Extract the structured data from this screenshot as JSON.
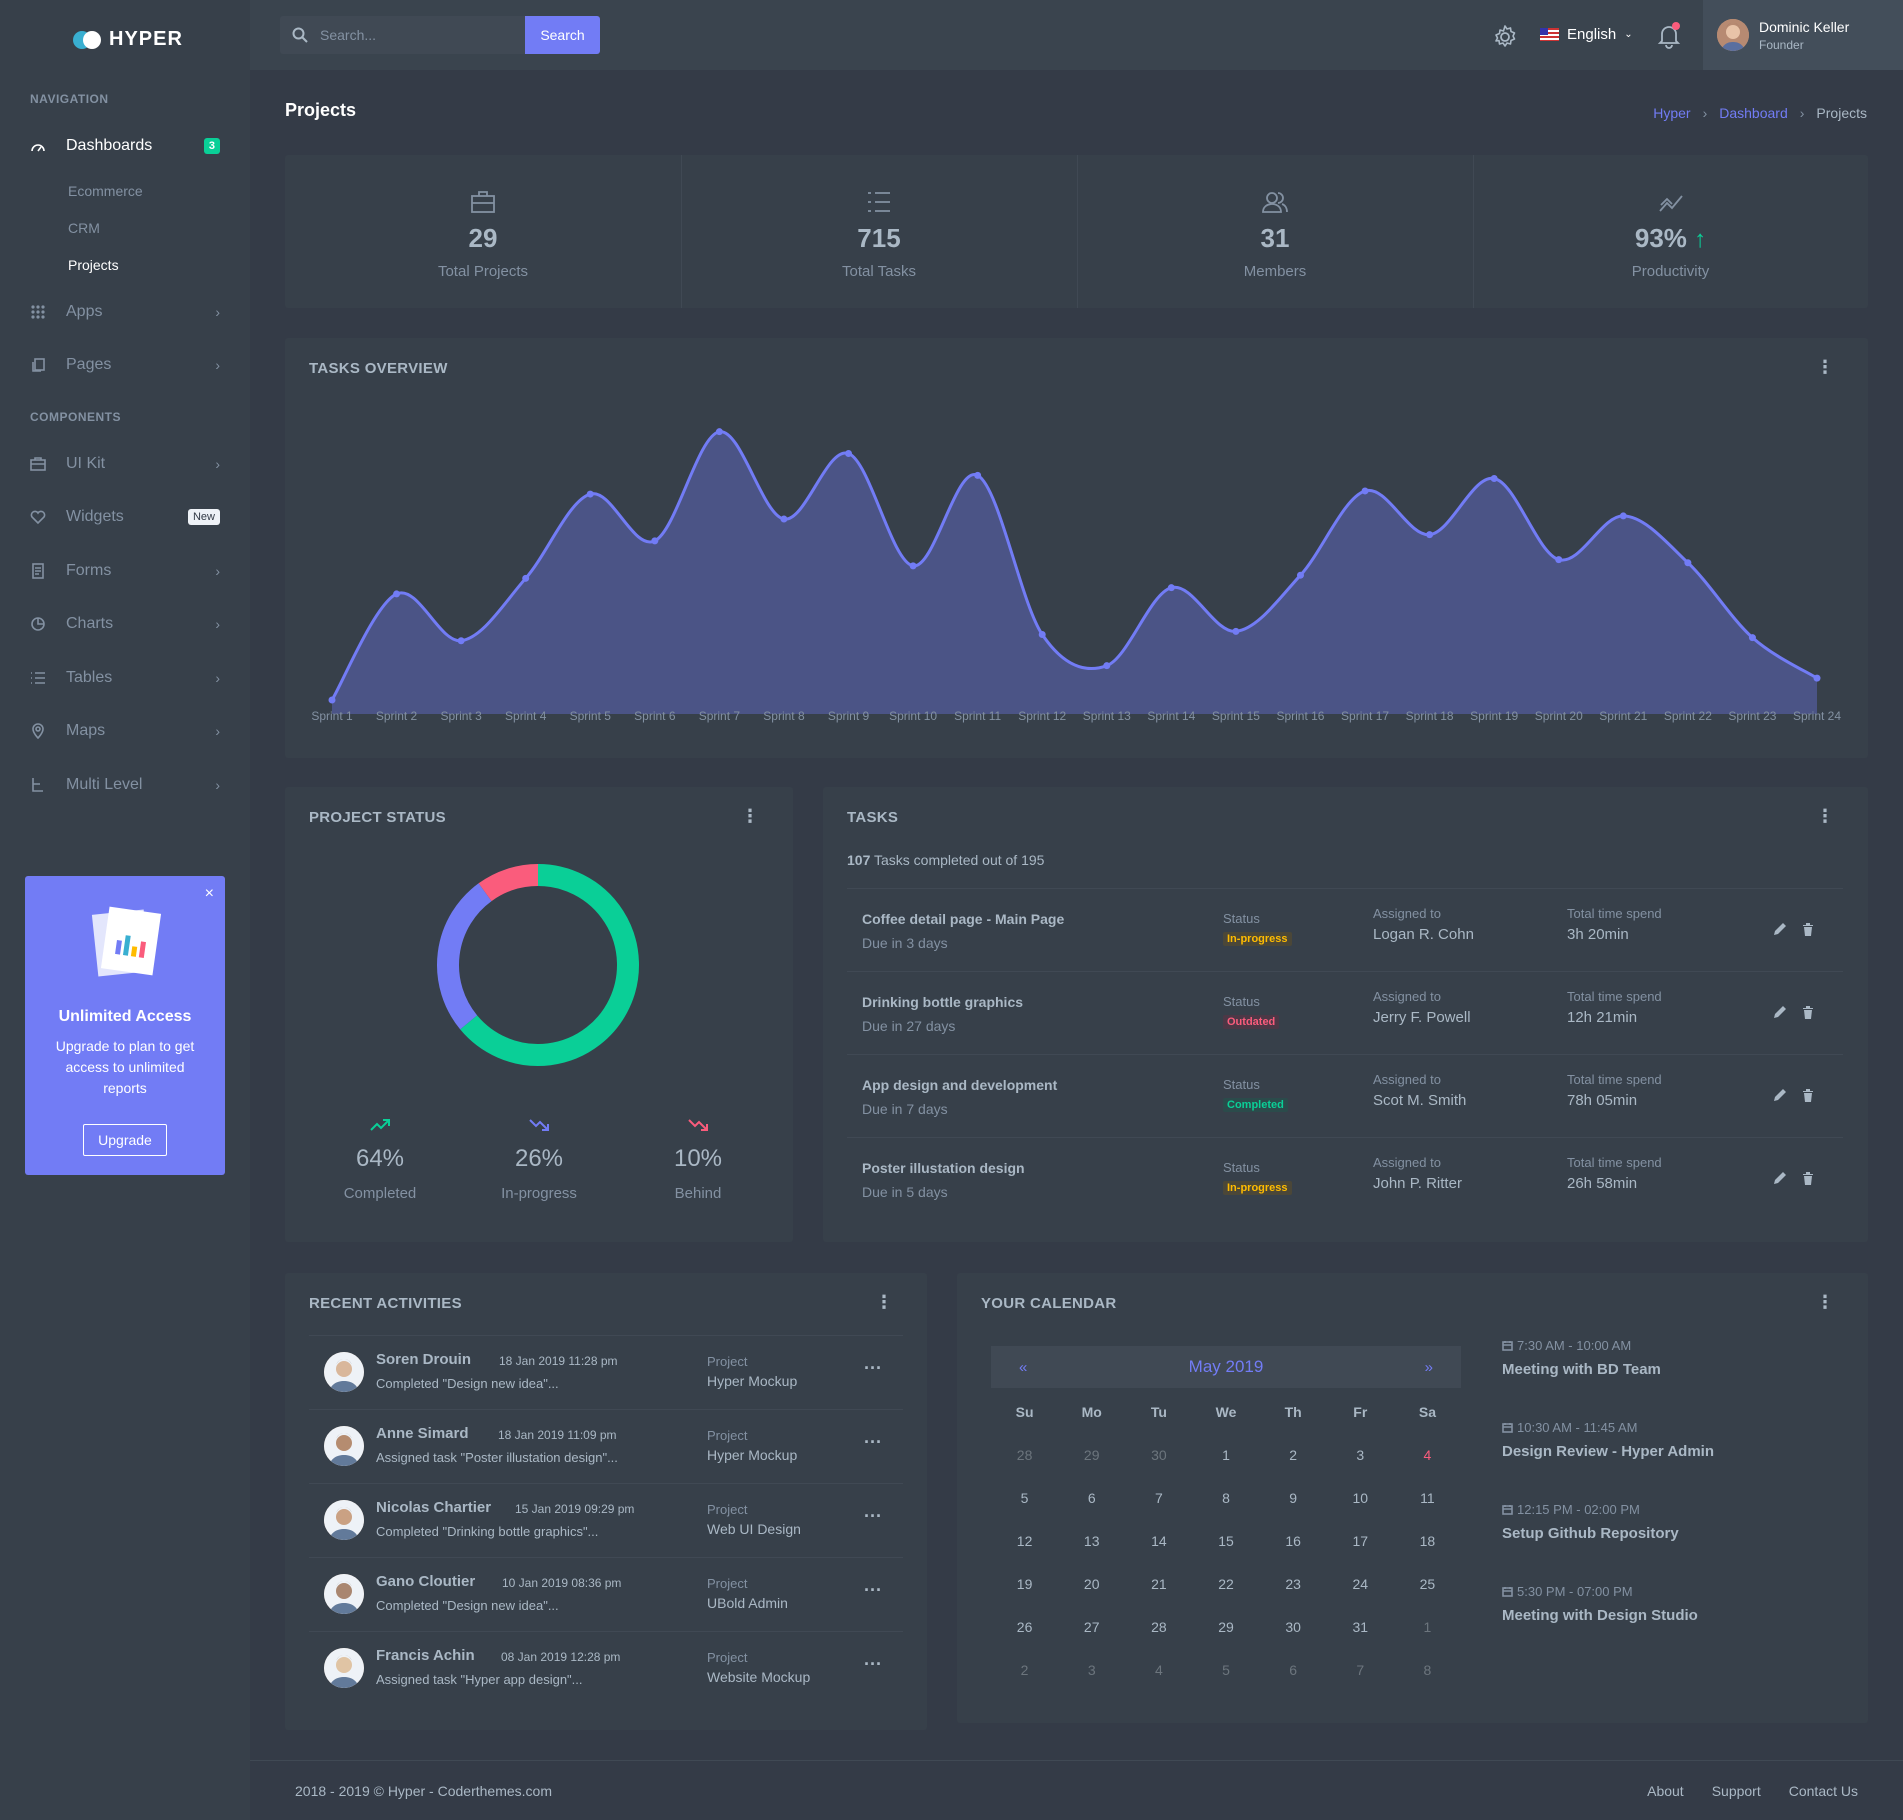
{
  "brand": {
    "name": "HYPER"
  },
  "sidebar": {
    "nav_title": "NAVIGATION",
    "components_title": "COMPONENTS",
    "dashboards": {
      "label": "Dashboards",
      "badge": "3",
      "sub": [
        "Ecommerce",
        "CRM",
        "Projects"
      ]
    },
    "apps": "Apps",
    "pages": "Pages",
    "items": [
      {
        "label": "UI Kit",
        "icon": "briefcase-icon"
      },
      {
        "label": "Widgets",
        "icon": "heart-icon",
        "badge": "New"
      },
      {
        "label": "Forms",
        "icon": "document-icon"
      },
      {
        "label": "Charts",
        "icon": "pie-chart-icon"
      },
      {
        "label": "Tables",
        "icon": "list-icon"
      },
      {
        "label": "Maps",
        "icon": "map-pin-icon"
      },
      {
        "label": "Multi Level",
        "icon": "tree-icon"
      }
    ],
    "promo": {
      "title": "Unlimited Access",
      "text": "Upgrade to plan to get access to unlimited reports",
      "button": "Upgrade"
    }
  },
  "topbar": {
    "search_placeholder": "Search...",
    "search_button": "Search",
    "language": "English",
    "user_name": "Dominic Keller",
    "user_role": "Founder"
  },
  "page": {
    "title": "Projects",
    "breadcrumb": [
      "Hyper",
      "Dashboard",
      "Projects"
    ]
  },
  "stats": [
    {
      "value": "29",
      "label": "Total Projects",
      "icon": "briefcase-icon"
    },
    {
      "value": "715",
      "label": "Total Tasks",
      "icon": "list-icon"
    },
    {
      "value": "31",
      "label": "Members",
      "icon": "users-icon"
    },
    {
      "value": "93%",
      "label": "Productivity",
      "icon": "trend-icon"
    }
  ],
  "tasks_overview": {
    "title": "TASKS OVERVIEW"
  },
  "chart_data": {
    "type": "area",
    "title": "TASKS OVERVIEW",
    "categories": [
      "Sprint 1",
      "Sprint 2",
      "Sprint 3",
      "Sprint 4",
      "Sprint 5",
      "Sprint 6",
      "Sprint 7",
      "Sprint 8",
      "Sprint 9",
      "Sprint 10",
      "Sprint 11",
      "Sprint 12",
      "Sprint 13",
      "Sprint 14",
      "Sprint 15",
      "Sprint 16",
      "Sprint 17",
      "Sprint 18",
      "Sprint 19",
      "Sprint 20",
      "Sprint 21",
      "Sprint 22",
      "Sprint 23",
      "Sprint 24"
    ],
    "values": [
      0,
      34,
      19,
      39,
      66,
      51,
      86,
      58,
      79,
      43,
      72,
      21,
      11,
      36,
      22,
      40,
      67,
      53,
      71,
      45,
      59,
      44,
      20,
      7
    ],
    "ylim": [
      0,
      100
    ],
    "color": "#727cf5",
    "grid": false
  },
  "project_status": {
    "title": "PROJECT STATUS",
    "chart_data": {
      "type": "pie",
      "values": [
        64,
        26,
        10
      ],
      "labels": [
        "Completed",
        "In-progress",
        "Behind"
      ],
      "colors": [
        "#0acf97",
        "#727cf5",
        "#fa5c7c"
      ]
    },
    "legend": [
      {
        "pct": "64%",
        "label": "Completed",
        "color": "#0acf97"
      },
      {
        "pct": "26%",
        "label": "In-progress",
        "color": "#727cf5"
      },
      {
        "pct": "10%",
        "label": "Behind",
        "color": "#fa5c7c"
      }
    ]
  },
  "tasks": {
    "title": "TASKS",
    "summary_count": "107",
    "summary_text": "Tasks completed out of 195",
    "status_label": "Status",
    "assigned_label": "Assigned to",
    "time_label": "Total time spend",
    "rows": [
      {
        "title": "Coffee detail page - Main Page",
        "due": "Due in 3 days",
        "status": "In-progress",
        "assignee": "Logan R. Cohn",
        "time": "3h 20min"
      },
      {
        "title": "Drinking bottle graphics",
        "due": "Due in 27 days",
        "status": "Outdated",
        "assignee": "Jerry F. Powell",
        "time": "12h 21min"
      },
      {
        "title": "App design and development",
        "due": "Due in 7 days",
        "status": "Completed",
        "assignee": "Scot M. Smith",
        "time": "78h 05min"
      },
      {
        "title": "Poster illustation design",
        "due": "Due in 5 days",
        "status": "In-progress",
        "assignee": "John P. Ritter",
        "time": "26h 58min"
      }
    ]
  },
  "activities": {
    "title": "RECENT ACTIVITIES",
    "project_label": "Project",
    "rows": [
      {
        "name": "Soren Drouin",
        "time": "18 Jan 2019 11:28 pm",
        "desc": "Completed \"Design new idea\"...",
        "project": "Hyper Mockup"
      },
      {
        "name": "Anne Simard",
        "time": "18 Jan 2019 11:09 pm",
        "desc": "Assigned task \"Poster illustation design\"...",
        "project": "Hyper Mockup"
      },
      {
        "name": "Nicolas Chartier",
        "time": "15 Jan 2019 09:29 pm",
        "desc": "Completed \"Drinking bottle graphics\"...",
        "project": "Web UI Design"
      },
      {
        "name": "Gano Cloutier",
        "time": "10 Jan 2019 08:36 pm",
        "desc": "Completed \"Design new idea\"...",
        "project": "UBold Admin"
      },
      {
        "name": "Francis Achin",
        "time": "08 Jan 2019 12:28 pm",
        "desc": "Assigned task \"Hyper app design\"...",
        "project": "Website Mockup"
      }
    ]
  },
  "calendar": {
    "title": "YOUR CALENDAR",
    "month": "May 2019",
    "prev": "«",
    "next": "»",
    "days": [
      "Su",
      "Mo",
      "Tu",
      "We",
      "Th",
      "Fr",
      "Sa"
    ],
    "weeks": [
      [
        "28",
        "29",
        "30",
        "1",
        "2",
        "3",
        "4"
      ],
      [
        "5",
        "6",
        "7",
        "8",
        "9",
        "10",
        "11"
      ],
      [
        "12",
        "13",
        "14",
        "15",
        "16",
        "17",
        "18"
      ],
      [
        "19",
        "20",
        "21",
        "22",
        "23",
        "24",
        "25"
      ],
      [
        "26",
        "27",
        "28",
        "29",
        "30",
        "31",
        "1"
      ],
      [
        "2",
        "3",
        "4",
        "5",
        "6",
        "7",
        "8"
      ]
    ],
    "events": [
      {
        "time": "7:30 AM - 10:00 AM",
        "title": "Meeting with BD Team"
      },
      {
        "time": "10:30 AM - 11:45 AM",
        "title": "Design Review - Hyper Admin"
      },
      {
        "time": "12:15 PM - 02:00 PM",
        "title": "Setup Github Repository"
      },
      {
        "time": "5:30 PM - 07:00 PM",
        "title": "Meeting with Design Studio"
      }
    ]
  },
  "footer": {
    "copyright": "2018 - 2019 © Hyper - Coderthemes.com",
    "links": [
      "About",
      "Support",
      "Contact Us"
    ]
  }
}
